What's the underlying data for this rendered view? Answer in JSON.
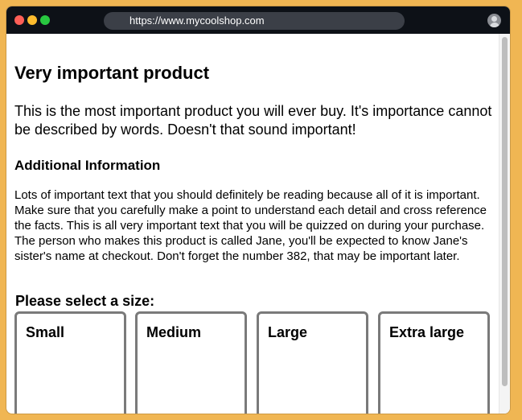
{
  "browser": {
    "url": "https://www.mycoolshop.com"
  },
  "product": {
    "title": "Very important product",
    "lead": "This is the most important product you will ever buy. It's importance cannot be described by words. Doesn't that sound important!",
    "additional_heading": "Additional Information",
    "additional_text": "Lots of important text that you should definitely be reading because all of it is important. Make sure that you carefully make a point to understand each detail and cross reference the facts. This is all very important text that you will be quizzed on during your purchase. The person who makes this product is called Jane, you'll be expected to know Jane's sister's name at checkout. Don't forget the number 382, that may be important later."
  },
  "size_selector": {
    "label": "Please select a size:",
    "options": [
      {
        "label": "Small"
      },
      {
        "label": "Medium"
      },
      {
        "label": "Large"
      },
      {
        "label": "Extra large"
      }
    ]
  },
  "colors": {
    "desktop_background": "#f0b653",
    "titlebar": "#0d1117",
    "urlbar": "#3b3f47",
    "card_border": "#7a7a7a"
  }
}
